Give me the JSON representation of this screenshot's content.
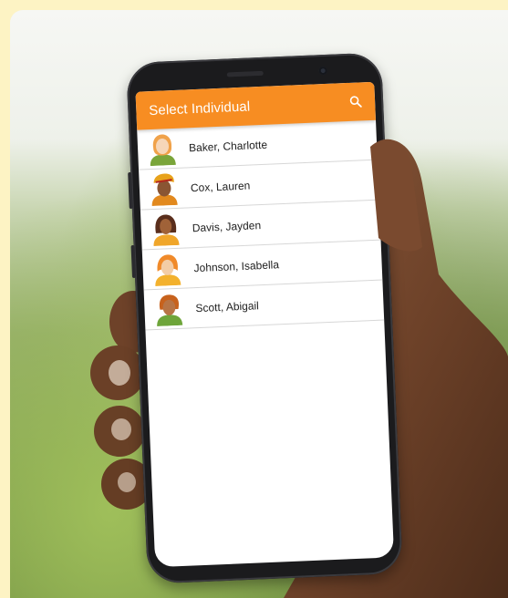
{
  "app": {
    "title": "Select Individual",
    "search_icon": "search-icon",
    "accent_color": "#f78d22"
  },
  "individuals": [
    {
      "name": "Baker, Charlotte",
      "avatar": "avatar-icon"
    },
    {
      "name": "Cox, Lauren",
      "avatar": "avatar-icon"
    },
    {
      "name": "Davis, Jayden",
      "avatar": "avatar-icon"
    },
    {
      "name": "Johnson, Isabella",
      "avatar": "avatar-icon"
    },
    {
      "name": "Scott, Abigail",
      "avatar": "avatar-icon"
    }
  ]
}
